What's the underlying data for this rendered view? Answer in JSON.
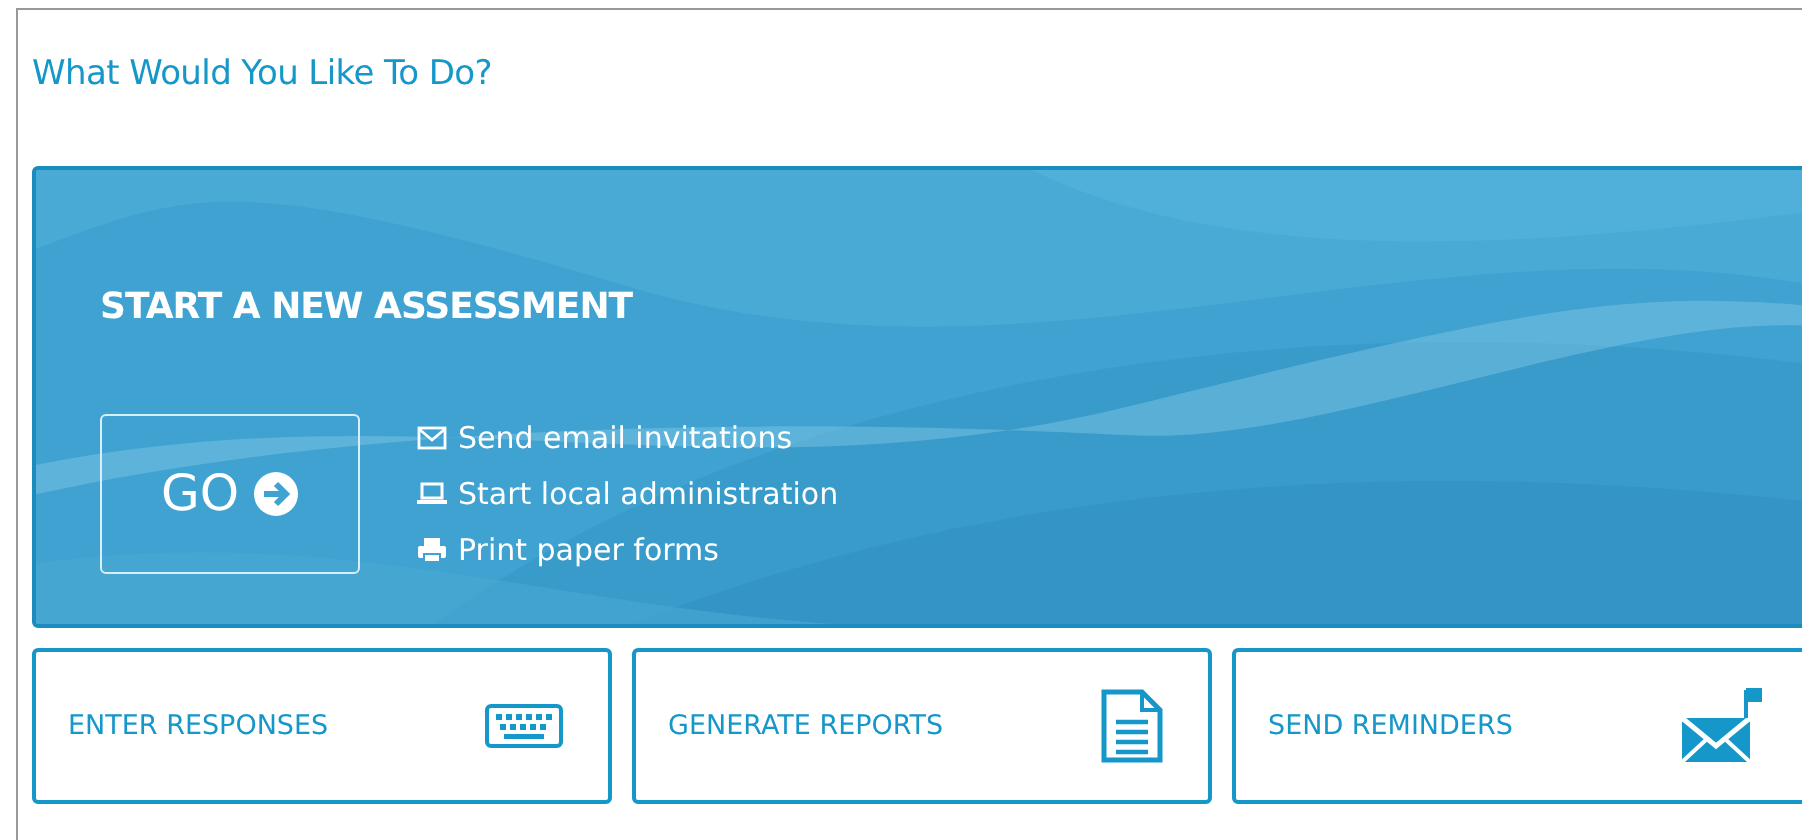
{
  "heading": "What Would You Like To Do?",
  "banner": {
    "title": "START A NEW ASSESSMENT",
    "go_label": "GO",
    "actions": [
      {
        "kind": "email",
        "label": "Send email invitations"
      },
      {
        "kind": "laptop",
        "label": "Start local administration"
      },
      {
        "kind": "print",
        "label": "Print paper forms"
      }
    ]
  },
  "tiles": [
    {
      "kind": "keyboard",
      "label": "ENTER RESPONSES"
    },
    {
      "kind": "document",
      "label": "GENERATE REPORTS"
    },
    {
      "kind": "mail",
      "label": "SEND REMINDERS"
    }
  ]
}
